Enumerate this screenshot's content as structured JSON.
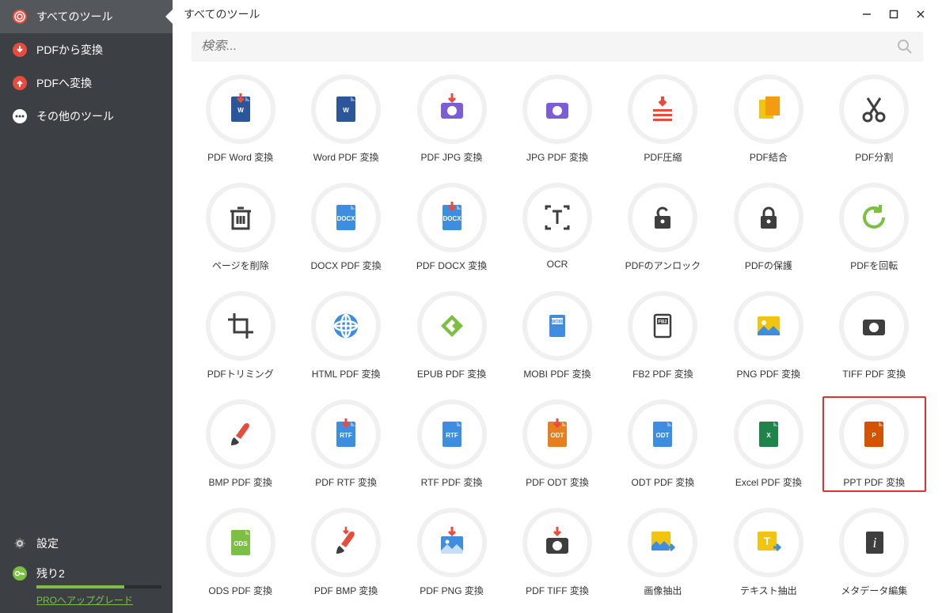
{
  "window": {
    "title": "すべてのツール"
  },
  "sidebar": {
    "items": [
      {
        "label": "すべてのツール"
      },
      {
        "label": "PDFから変換"
      },
      {
        "label": "PDFへ変換"
      },
      {
        "label": "その他のツール"
      }
    ],
    "settings_label": "設定",
    "remaining_label": "残り2",
    "upgrade_label": "PROへアップグレード"
  },
  "search": {
    "placeholder": "検索..."
  },
  "tools": [
    {
      "label": "PDF Word 変換",
      "icon": "word-in",
      "color": "#2b579a"
    },
    {
      "label": "Word PDF 変換",
      "icon": "word",
      "color": "#2b579a"
    },
    {
      "label": "PDF JPG 変換",
      "icon": "camera-dl",
      "color": "#7b5ed6"
    },
    {
      "label": "JPG PDF 変換",
      "icon": "camera",
      "color": "#7b5ed6"
    },
    {
      "label": "PDF圧縮",
      "icon": "compress",
      "color": "#e84c3d"
    },
    {
      "label": "PDF結合",
      "icon": "merge",
      "color": "#f1c40f"
    },
    {
      "label": "PDF分割",
      "icon": "scissors",
      "color": "#3e3e3e"
    },
    {
      "label": "ページを削除",
      "icon": "trash",
      "color": "#3e3e3e"
    },
    {
      "label": "DOCX PDF 変換",
      "icon": "docx",
      "color": "#3d8ee0"
    },
    {
      "label": "PDF DOCX 変換",
      "icon": "docx-in",
      "color": "#3d8ee0"
    },
    {
      "label": "OCR",
      "icon": "ocr",
      "color": "#3e3e3e"
    },
    {
      "label": "PDFのアンロック",
      "icon": "unlock",
      "color": "#3e3e3e"
    },
    {
      "label": "PDFの保護",
      "icon": "lock",
      "color": "#3e3e3e"
    },
    {
      "label": "PDFを回転",
      "icon": "rotate",
      "color": "#7bc043"
    },
    {
      "label": "PDFトリミング",
      "icon": "crop",
      "color": "#3e3e3e"
    },
    {
      "label": "HTML PDF 変換",
      "icon": "globe",
      "color": "#3d8ee0"
    },
    {
      "label": "EPUB PDF 変換",
      "icon": "epub",
      "color": "#7bc043"
    },
    {
      "label": "MOBI PDF 変換",
      "icon": "mobi",
      "color": "#3d8ee0"
    },
    {
      "label": "FB2 PDF 変換",
      "icon": "fb2",
      "color": "#3e3e3e"
    },
    {
      "label": "PNG PDF 変換",
      "icon": "image",
      "color": "#f1c40f"
    },
    {
      "label": "TIFF PDF 変換",
      "icon": "camera-bw",
      "color": "#3e3e3e"
    },
    {
      "label": "BMP PDF 変換",
      "icon": "brush",
      "color": "#e84c3d"
    },
    {
      "label": "PDF RTF 変換",
      "icon": "rtf-in",
      "color": "#3d8ee0"
    },
    {
      "label": "RTF PDF 変換",
      "icon": "rtf",
      "color": "#3d8ee0"
    },
    {
      "label": "PDF ODT 変換",
      "icon": "odt-in",
      "color": "#e67e22"
    },
    {
      "label": "ODT PDF 変換",
      "icon": "odt",
      "color": "#3d8ee0"
    },
    {
      "label": "Excel PDF 変換",
      "icon": "excel",
      "color": "#1e8449"
    },
    {
      "label": "PPT PDF 変換",
      "icon": "ppt",
      "color": "#d35400",
      "highlight": true
    },
    {
      "label": "ODS PDF 変換",
      "icon": "ods",
      "color": "#7bc043"
    },
    {
      "label": "PDF BMP 変換",
      "icon": "brush-dl",
      "color": "#e84c3d"
    },
    {
      "label": "PDF PNG 変換",
      "icon": "image-dl",
      "color": "#3d8ee0"
    },
    {
      "label": "PDF TIFF 変換",
      "icon": "camera-dl2",
      "color": "#3e3e3e"
    },
    {
      "label": "画像抽出",
      "icon": "img-extract",
      "color": "#f1c40f"
    },
    {
      "label": "テキスト抽出",
      "icon": "txt-extract",
      "color": "#f1c40f"
    },
    {
      "label": "メタデータ編集",
      "icon": "metadata",
      "color": "#3e3e3e"
    }
  ]
}
